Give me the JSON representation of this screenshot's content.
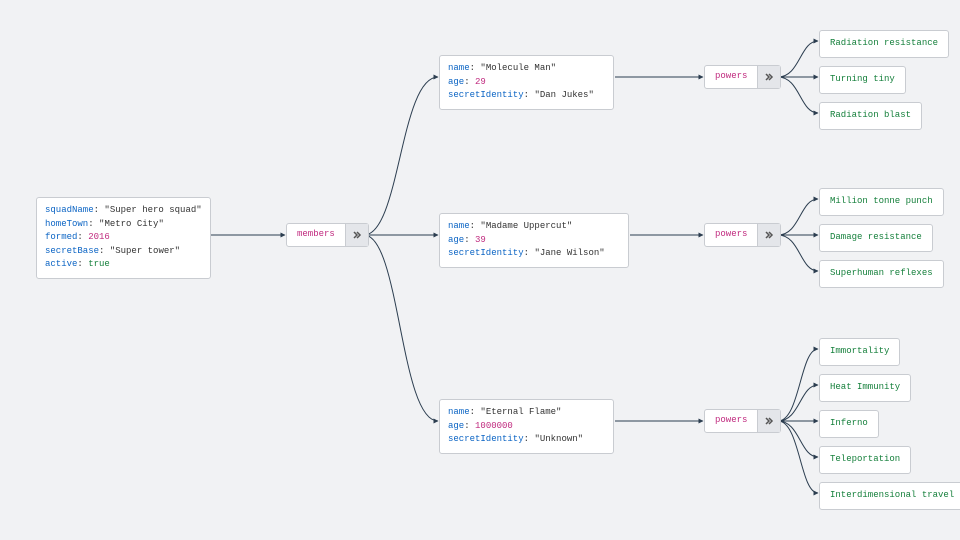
{
  "root": {
    "squadName": "Super hero squad",
    "homeTown": "Metro City",
    "formed": 2016,
    "secretBase": "Super tower",
    "active": true
  },
  "labels": {
    "squadName": "squadName",
    "homeTown": "homeTown",
    "formed": "formed",
    "secretBase": "secretBase",
    "active": "active",
    "name": "name",
    "age": "age",
    "secretIdentity": "secretIdentity",
    "members": "members",
    "powers": "powers"
  },
  "members": [
    {
      "name": "Molecule Man",
      "age": 29,
      "secretIdentity": "Dan Jukes",
      "powers": [
        "Radiation resistance",
        "Turning tiny",
        "Radiation blast"
      ]
    },
    {
      "name": "Madame Uppercut",
      "age": 39,
      "secretIdentity": "Jane Wilson",
      "powers": [
        "Million tonne punch",
        "Damage resistance",
        "Superhuman reflexes"
      ]
    },
    {
      "name": "Eternal Flame",
      "age": 1000000,
      "secretIdentity": "Unknown",
      "powers": [
        "Immortality",
        "Heat Immunity",
        "Inferno",
        "Teleportation",
        "Interdimensional travel"
      ]
    }
  ]
}
